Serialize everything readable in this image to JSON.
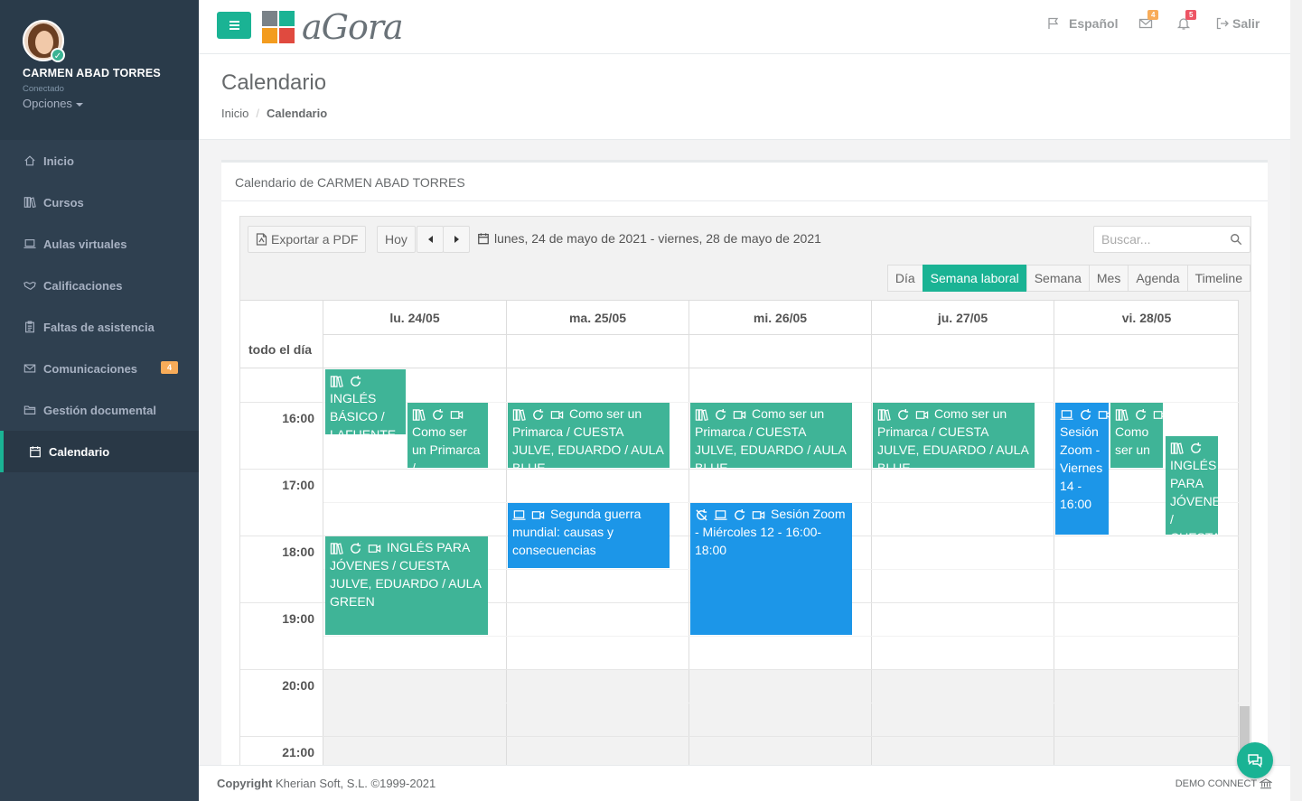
{
  "profile": {
    "name": "CARMEN ABAD TORRES",
    "status": "Conectado",
    "options": "Opciones"
  },
  "nav": [
    {
      "label": "Inicio",
      "icon": "home-icon"
    },
    {
      "label": "Cursos",
      "icon": "books-icon"
    },
    {
      "label": "Aulas virtuales",
      "icon": "laptop-icon"
    },
    {
      "label": "Calificaciones",
      "icon": "handshake-icon"
    },
    {
      "label": "Faltas de asistencia",
      "icon": "clipboard-icon"
    },
    {
      "label": "Comunicaciones",
      "icon": "envelope-icon",
      "badge": "4"
    },
    {
      "label": "Gestión documental",
      "icon": "folder-icon"
    },
    {
      "label": "Calendario",
      "icon": "calendar-icon",
      "active": true
    }
  ],
  "topbar": {
    "logo_text": "aGora",
    "language": "Español",
    "mail_badge": "4",
    "bell_badge": "5",
    "logout": "Salir"
  },
  "heading": {
    "title": "Calendario",
    "breadcrumb_home": "Inicio",
    "breadcrumb_current": "Calendario"
  },
  "box": {
    "title": "Calendario de CARMEN ABAD TORRES"
  },
  "toolbar": {
    "export_pdf": "Exportar a PDF",
    "today": "Hoy",
    "date_range": "lunes, 24 de mayo de 2021 - viernes, 28 de mayo de 2021",
    "search_placeholder": "Buscar...",
    "views": [
      "Día",
      "Semana laboral",
      "Semana",
      "Mes",
      "Agenda",
      "Timeline"
    ],
    "active_view": "Semana laboral"
  },
  "calendar": {
    "all_day_label": "todo el día",
    "days": [
      "lu. 24/05",
      "ma. 25/05",
      "mi. 26/05",
      "ju. 27/05",
      "vi. 28/05"
    ],
    "times": [
      "16:00",
      "17:00",
      "18:00",
      "19:00",
      "20:00",
      "21:00"
    ],
    "events": [
      {
        "text": "INGLÉS BÁSICO / LAFUENTE",
        "color": "green",
        "icons": [
          "books-icon",
          "repeat-icon"
        ]
      },
      {
        "text": "Como ser un Primarca /",
        "color": "green",
        "icons": [
          "books-icon",
          "repeat-icon",
          "video-icon"
        ]
      },
      {
        "text": "INGLÉS PARA JÓVENES / CUESTA JULVE, EDUARDO / AULA GREEN",
        "color": "green",
        "icons": [
          "books-icon",
          "repeat-icon",
          "video-icon"
        ]
      },
      {
        "text": "Como ser un Primarca / CUESTA JULVE, EDUARDO / AULA BLUE",
        "color": "green",
        "icons": [
          "books-icon",
          "repeat-icon",
          "video-icon"
        ]
      },
      {
        "text": "Segunda guerra mundial: causas y consecuencias",
        "color": "blue",
        "icons": [
          "laptop-icon",
          "video-icon"
        ]
      },
      {
        "text": "Como ser un Primarca / CUESTA JULVE, EDUARDO / AULA BLUE",
        "color": "green",
        "icons": [
          "books-icon",
          "repeat-icon",
          "video-icon"
        ]
      },
      {
        "text": "Sesión Zoom - Miércoles 12 - 16:00-18:00",
        "color": "blue",
        "icons": [
          "no-repeat-icon",
          "laptop-icon",
          "repeat-icon",
          "video-icon"
        ]
      },
      {
        "text": "Como ser un Primarca / CUESTA JULVE, EDUARDO / AULA BLUE",
        "color": "green",
        "icons": [
          "books-icon",
          "repeat-icon",
          "video-icon"
        ]
      },
      {
        "text": "Sesión Zoom - Viernes 14 - 16:00",
        "color": "blue",
        "icons": [
          "laptop-icon",
          "repeat-icon",
          "video-icon"
        ]
      },
      {
        "text": "Como ser un",
        "color": "green",
        "icons": [
          "books-icon",
          "repeat-icon",
          "video-icon"
        ]
      },
      {
        "text": "INGLÉS PARA JÓVENES / CUESTA",
        "color": "green",
        "icons": [
          "books-icon",
          "repeat-icon"
        ]
      }
    ]
  },
  "footer": {
    "copyright_bold": "Copyright",
    "copyright_rest": "Kherian Soft, S.L. ©1999-2021",
    "right": "DEMO CONNECT"
  },
  "colors": {
    "sidebar": "#2f4050",
    "accent": "#1ab394",
    "event_green": "#3fb497",
    "event_blue": "#1c96e8",
    "badge_orange": "#f8ac59",
    "badge_red": "#ed5565"
  }
}
